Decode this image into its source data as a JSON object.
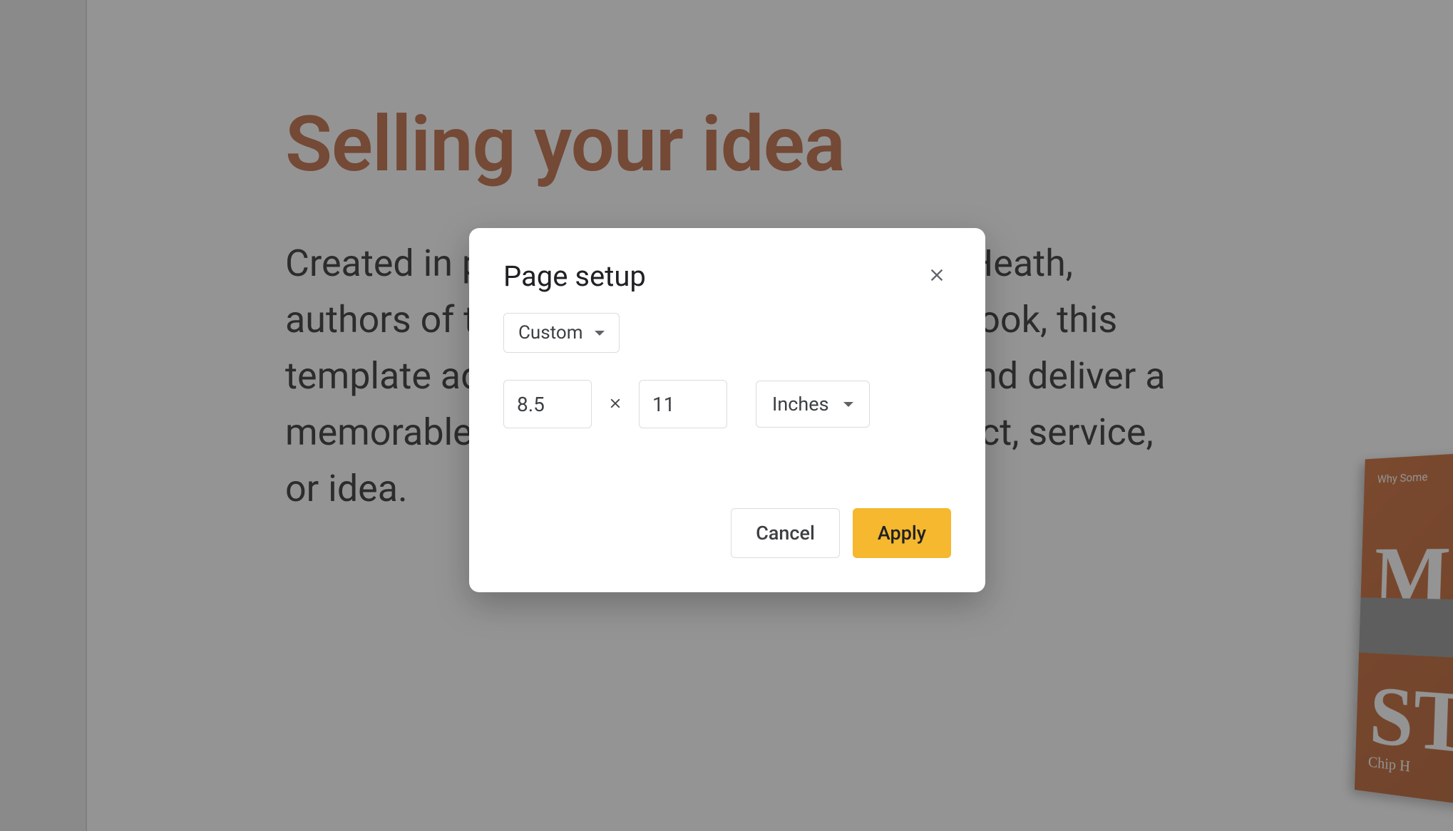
{
  "slide": {
    "title": "Selling your idea",
    "body": "Created in partnership with Chip and Dan Heath, authors of the best-selling Made to Stick book, this template advises users on how to shape and deliver a memorable presentation about their product, service, or idea."
  },
  "book": {
    "top_label": "Why Some",
    "letter_1": "M",
    "letter_2": "ST",
    "author": "Chip H"
  },
  "dialog": {
    "title": "Page setup",
    "preset_label": "Custom",
    "width_value": "8.5",
    "height_value": "11",
    "units_label": "Inches",
    "cancel_label": "Cancel",
    "apply_label": "Apply"
  }
}
